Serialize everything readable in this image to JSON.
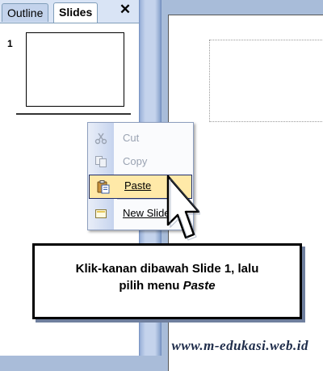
{
  "pane": {
    "tabs": [
      {
        "label": "Outline",
        "active": false
      },
      {
        "label": "Slides",
        "active": true
      }
    ],
    "close_glyph": "✕",
    "slide_number": "1"
  },
  "context_menu": {
    "items": [
      {
        "label": "Cut",
        "icon": "scissors-icon",
        "enabled": false
      },
      {
        "label": "Copy",
        "icon": "copy-icon",
        "enabled": false
      },
      {
        "label": "Paste",
        "icon": "clipboard-paste-icon",
        "enabled": true,
        "highlighted": true
      },
      {
        "label": "New Slide",
        "icon": "new-slide-icon",
        "enabled": true
      }
    ]
  },
  "caption": {
    "line1": "Klik-kanan dibawah Slide 1, lalu",
    "line2_prefix": "pilih menu ",
    "line2_emphasis": "Paste"
  },
  "watermark": "www.m-edukasi.web.id",
  "colors": {
    "highlight": "#ffe9a8",
    "highlight_border": "#1f2d6b",
    "workspace": "#a9bcd9"
  }
}
